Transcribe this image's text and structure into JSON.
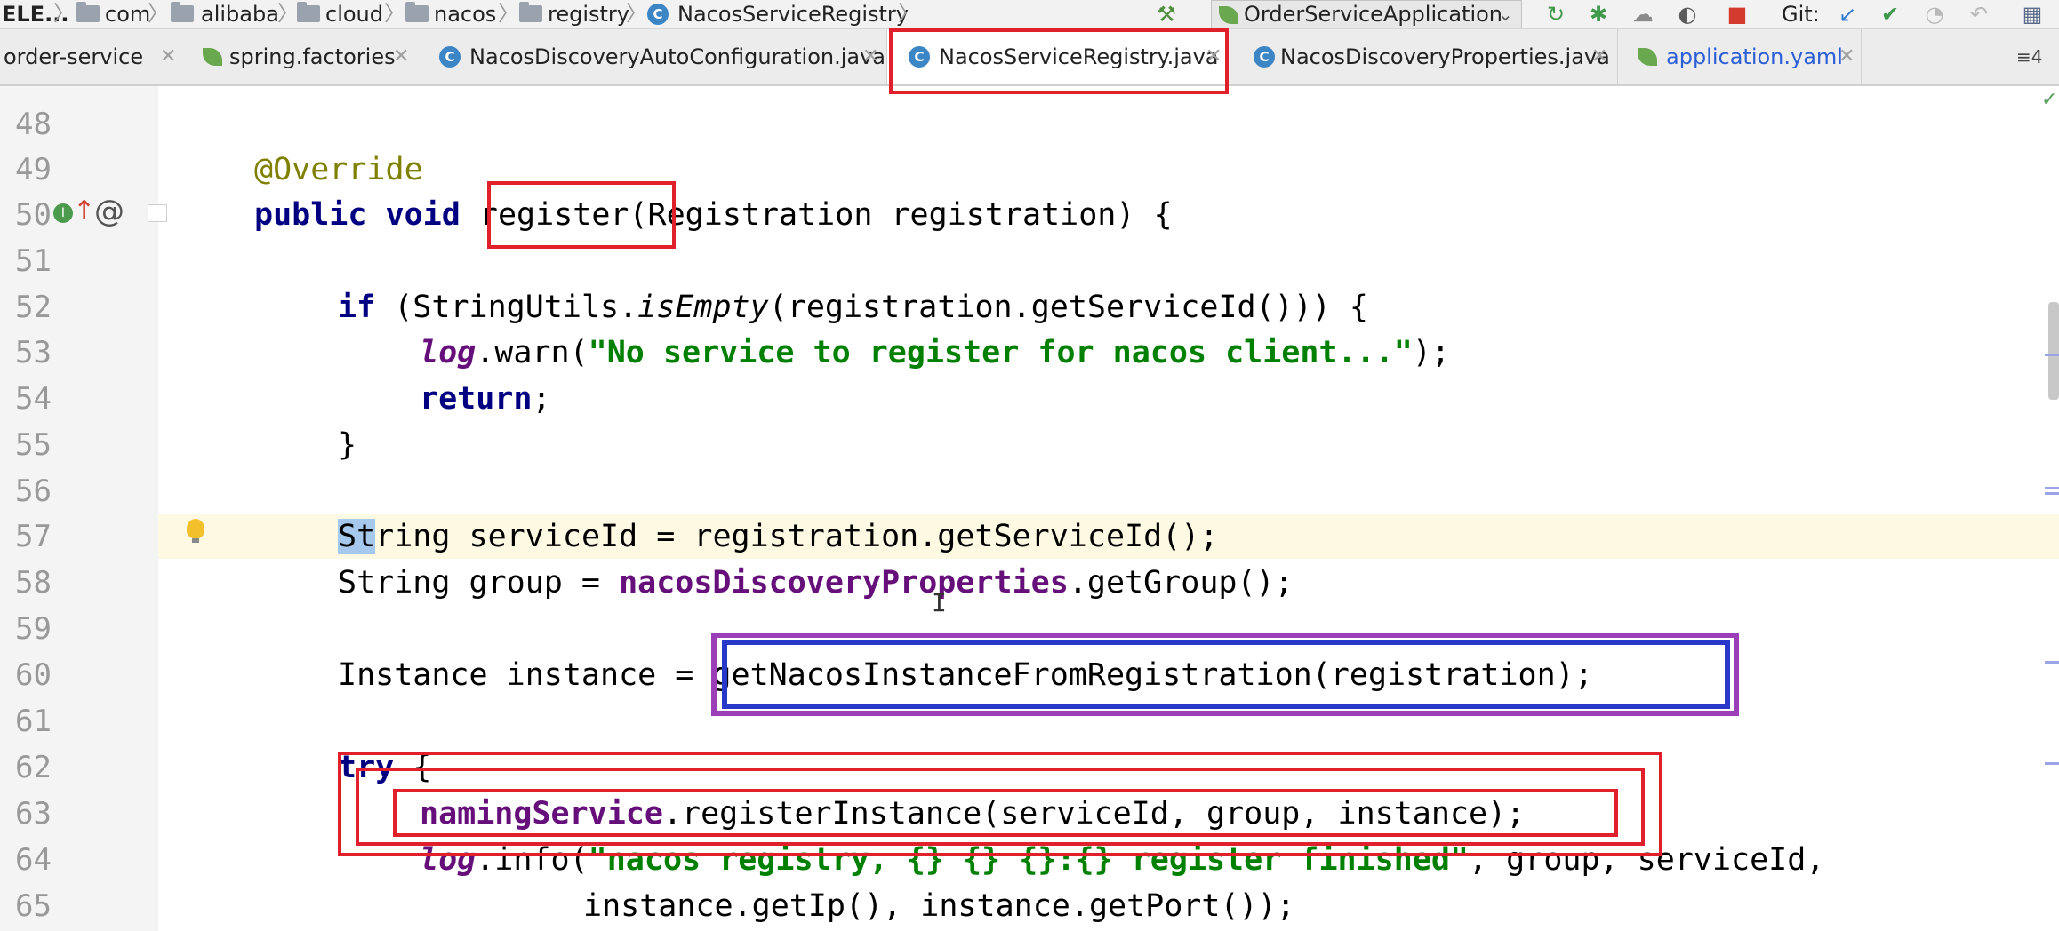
{
  "breadcrumbs": [
    {
      "label": "ELE...",
      "icon": "none"
    },
    {
      "label": "com",
      "icon": "folder-icon"
    },
    {
      "label": "alibaba",
      "icon": "folder-icon"
    },
    {
      "label": "cloud",
      "icon": "folder-icon"
    },
    {
      "label": "nacos",
      "icon": "folder-icon"
    },
    {
      "label": "registry",
      "icon": "folder-icon"
    },
    {
      "label": "NacosServiceRegistry",
      "icon": "class-icon"
    }
  ],
  "toolbar": {
    "build_icon": "hammer-icon",
    "run_config_label": "OrderServiceApplication",
    "git_label": "Git:",
    "icons": [
      "rerun-icon",
      "debug-icon",
      "coverage-icon",
      "profile-icon",
      "stop-icon",
      "git-update-icon",
      "git-commit-icon",
      "history-icon",
      "revert-icon",
      "structure-icon"
    ]
  },
  "tabs": [
    {
      "label": "order-service",
      "icon": "module-icon",
      "active": false
    },
    {
      "label": "spring.factories",
      "icon": "spring-icon",
      "active": false
    },
    {
      "label": "NacosDiscoveryAutoConfiguration.java",
      "icon": "class-icon",
      "active": false
    },
    {
      "label": "NacosServiceRegistry.java",
      "icon": "class-icon",
      "active": true
    },
    {
      "label": "NacosDiscoveryProperties.java",
      "icon": "class-icon",
      "active": false
    },
    {
      "label": "application.yaml",
      "icon": "spring-icon",
      "active": false
    }
  ],
  "tab_overflow": "≡4",
  "editor": {
    "line_numbers": [
      "48",
      "49",
      "50",
      "51",
      "52",
      "53",
      "54",
      "55",
      "56",
      "57",
      "58",
      "59",
      "60",
      "61",
      "62",
      "63",
      "64",
      "65"
    ],
    "current_line": "57",
    "code": {
      "l49_ann": "@Override",
      "l50_public": "public",
      "l50_void": "void",
      "l50_method": "register",
      "l50_rest": "(Registration registration) {",
      "l52_if": "if",
      "l52_a": " (StringUtils.",
      "l52_isEmpty": "isEmpty",
      "l52_b": "(registration.getServiceId())) {",
      "l53_log": "log",
      "l53_a": ".warn(",
      "l53_str": "\"No service to register for nacos client...\"",
      "l53_b": ");",
      "l54_return": "return",
      "l54_semi": ";",
      "l55": "}",
      "l57_sel": "St",
      "l57_rest": "ring serviceId = registration.getServiceId();",
      "l58_a": "String group = ",
      "l58_field": "nacosDiscoveryProperties",
      "l58_b": ".getGroup();",
      "l60": "Instance instance = getNacosInstanceFromRegistration(registration);",
      "l62_try": "try",
      "l62_brace": " {",
      "l63_field": "namingService",
      "l63_rest": ".registerInstance(serviceId, group, instance);",
      "l64_log": "log",
      "l64_a": ".info(",
      "l64_str": "\"nacos registry, {} {} {}:{} register finished\"",
      "l64_b": ", group, serviceId,",
      "l65": "instance.getIp(), instance.getPort());"
    }
  },
  "colors": {
    "highlight_red": "#e0202a",
    "highlight_blue": "#2838c8",
    "highlight_purple": "#9a3fb8",
    "keyword": "#000080",
    "string": "#008000",
    "field": "#660e7a"
  }
}
